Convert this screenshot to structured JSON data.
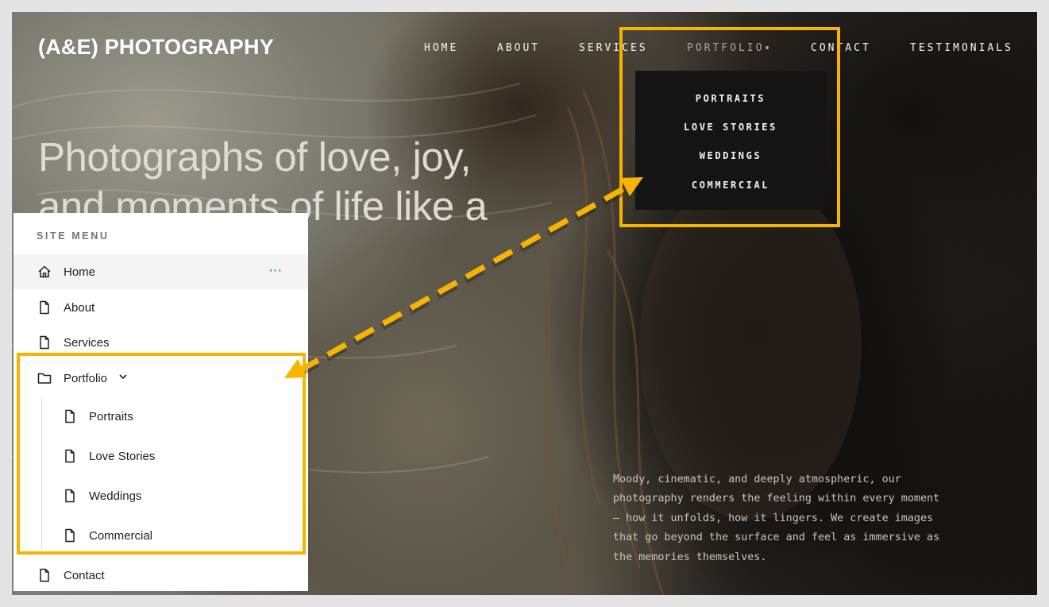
{
  "site": {
    "logo": "(A&E) PHOTOGRAPHY",
    "nav": [
      {
        "label": "HOME"
      },
      {
        "label": "ABOUT"
      },
      {
        "label": "SERVICES"
      },
      {
        "label": "PORTFOLIO",
        "active": true
      },
      {
        "label": "CONTACT"
      },
      {
        "label": "TESTIMONIALS"
      }
    ],
    "portfolio_dropdown": [
      "PORTRAITS",
      "LOVE STORIES",
      "WEDDINGS",
      "COMMERCIAL"
    ],
    "headline": "Photographs of love, joy, and moments of life like a movie",
    "tagline": "Moody, cinematic, and deeply atmospheric, our photography renders the feeling within every moment — how it unfolds, how it lingers. We create images that go beyond the surface and feel as immersive as the memories themselves."
  },
  "site_menu": {
    "title": "SITE MENU",
    "items": [
      {
        "label": "Home",
        "icon": "home-icon",
        "more": "···"
      },
      {
        "label": "About",
        "icon": "page-icon"
      },
      {
        "label": "Services",
        "icon": "page-icon"
      },
      {
        "label": "Portfolio",
        "icon": "folder-icon"
      },
      {
        "label": "Portraits",
        "icon": "page-icon"
      },
      {
        "label": "Love Stories",
        "icon": "page-icon"
      },
      {
        "label": "Weddings",
        "icon": "page-icon"
      },
      {
        "label": "Commercial",
        "icon": "page-icon"
      },
      {
        "label": "Contact",
        "icon": "page-icon"
      }
    ]
  },
  "colors": {
    "highlight": "#f5b400",
    "more_dots": "#1aa58a",
    "dropdown_bg": "#141414"
  }
}
